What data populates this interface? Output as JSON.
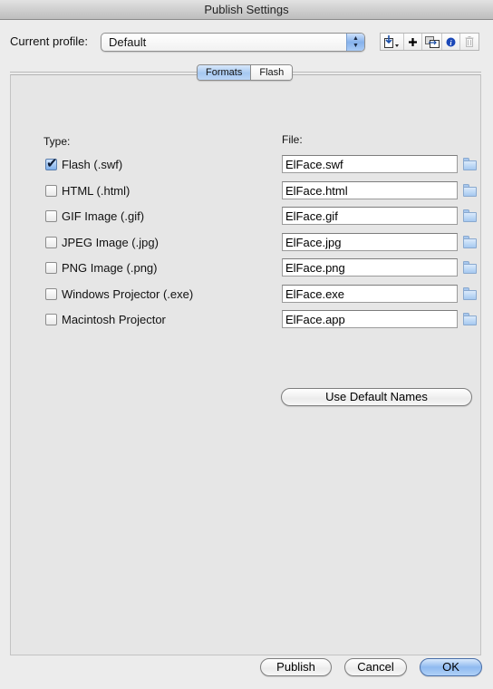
{
  "window": {
    "title": "Publish Settings"
  },
  "profile": {
    "label": "Current profile:",
    "selected": "Default",
    "toolbar": [
      {
        "icon": "import-export-icon",
        "label": "Import/Export profile"
      },
      {
        "icon": "plus-icon",
        "label": "Create new profile"
      },
      {
        "icon": "duplicate-icon",
        "label": "Duplicate profile"
      },
      {
        "icon": "info-icon",
        "label": "Profile properties"
      },
      {
        "icon": "trash-icon",
        "label": "Delete profile",
        "disabled": true
      }
    ]
  },
  "tabs": [
    {
      "label": "Formats",
      "active": true
    },
    {
      "label": "Flash",
      "active": false
    }
  ],
  "formats": {
    "type_header": "Type:",
    "file_header": "File:",
    "rows": [
      {
        "type": "Flash  (.swf)",
        "checked": true,
        "file": "ElFace.swf"
      },
      {
        "type": "HTML (.html)",
        "checked": false,
        "file": "ElFace.html"
      },
      {
        "type": "GIF Image (.gif)",
        "checked": false,
        "file": "ElFace.gif"
      },
      {
        "type": "JPEG Image (.jpg)",
        "checked": false,
        "file": "ElFace.jpg"
      },
      {
        "type": "PNG Image (.png)",
        "checked": false,
        "file": "ElFace.png"
      },
      {
        "type": "Windows Projector (.exe)",
        "checked": false,
        "file": "ElFace.exe"
      },
      {
        "type": "Macintosh Projector",
        "checked": false,
        "file": "ElFace.app"
      }
    ],
    "use_default_names": "Use Default Names"
  },
  "footer": {
    "publish": "Publish",
    "cancel": "Cancel",
    "ok": "OK"
  }
}
